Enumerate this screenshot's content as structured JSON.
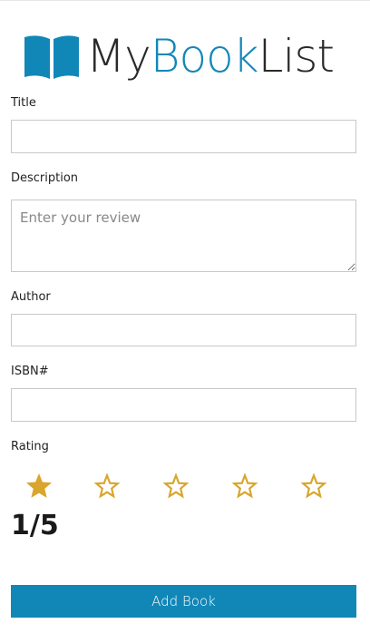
{
  "logo": {
    "part1": "My",
    "part2": "Book",
    "part3": "List",
    "icon": "open-book-icon",
    "accent_color": "#1187b8"
  },
  "form": {
    "title_label": "Title",
    "title_value": "",
    "description_label": "Description",
    "description_placeholder": "Enter your review",
    "author_label": "Author",
    "author_value": "",
    "isbn_label": "ISBN#",
    "isbn_value": "",
    "rating_label": "Rating",
    "rating": {
      "value": 1,
      "max": 5,
      "display": "1/5",
      "filled_icon": "star-filled-icon",
      "empty_icon": "star-outline-icon",
      "star_color": "#d9a52b"
    },
    "submit_label": "Add Book",
    "submit_color": "#1187b8"
  }
}
